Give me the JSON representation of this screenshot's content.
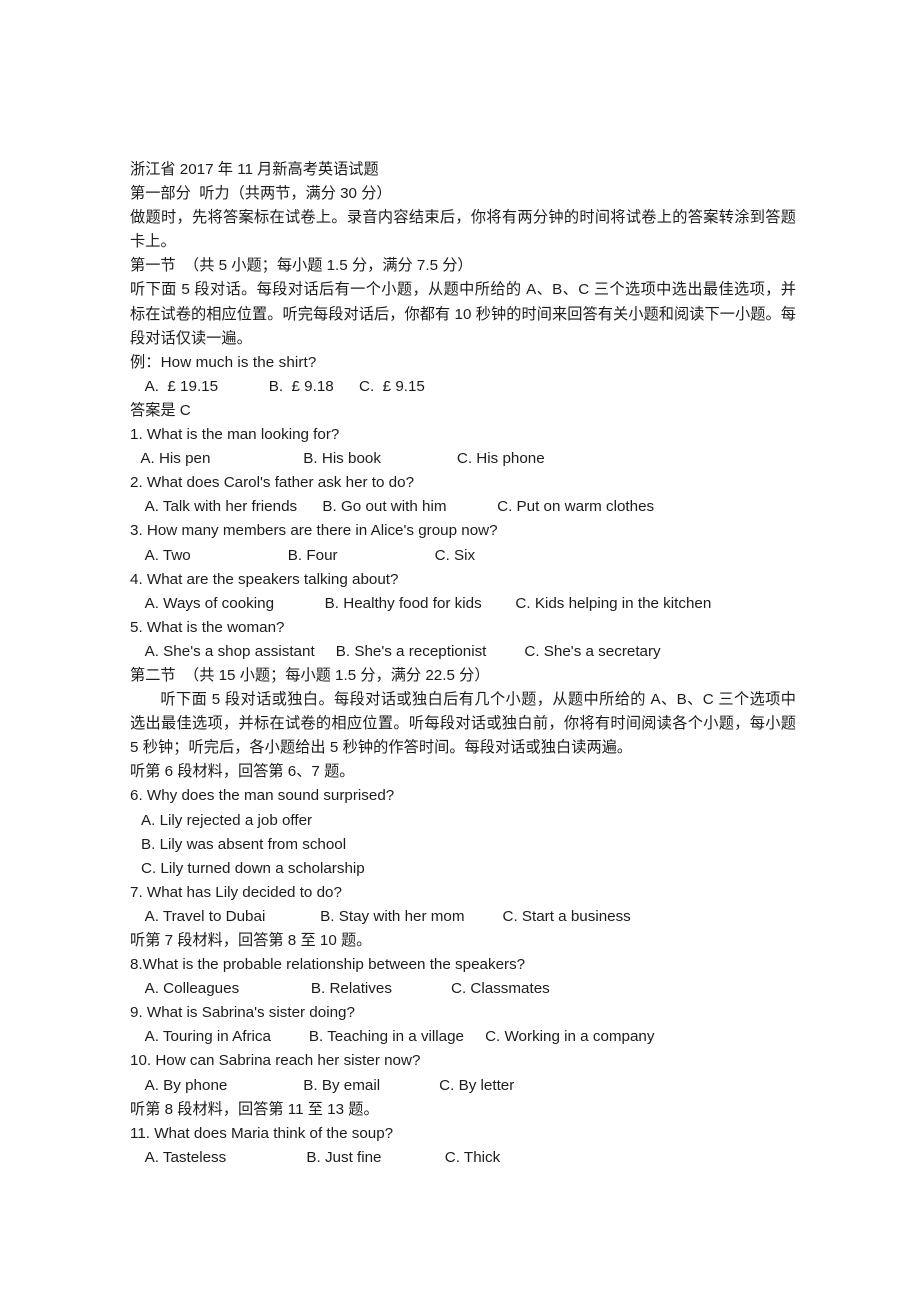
{
  "document": {
    "title": "浙江省 2017 年 11 月新高考英语试题",
    "part_one_heading": "第一部分  听力（共两节，满分 30 分）",
    "part_one_instruction": "做题时，先将答案标在试卷上。录音内容结束后，你将有两分钟的时间将试卷上的答案转涂到答题卡上。",
    "section_one": {
      "heading": "第一节  （共 5 小题；每小题 1.5 分，满分 7.5 分）",
      "instruction": "听下面 5 段对话。每段对话后有一个小题，从题中所给的 A、B、C 三个选项中选出最佳选项，并标在试卷的相应位置。听完每段对话后，你都有 10 秒钟的时间来回答有关小题和阅读下一小题。每段对话仅读一遍。",
      "example_label": "例：How much is the shirt?",
      "example_options": "  A.  £ 19.15            B.  £ 9.18      C.  £ 9.15",
      "example_answer": "答案是 C",
      "questions": [
        {
          "stem": "1. What is the man looking for?",
          "options_line": " A. His pen                      B. His book                  C. His phone"
        },
        {
          "stem": "2. What does Carol's father ask her to do?",
          "options_line": "  A. Talk with her friends      B. Go out with him            C. Put on warm clothes"
        },
        {
          "stem": "3. How many members are there in Alice's group now?",
          "options_line": "  A. Two                       B. Four                       C. Six"
        },
        {
          "stem": "4. What are the speakers talking about?",
          "options_line": "  A. Ways of cooking            B. Healthy food for kids        C. Kids helping in the kitchen"
        },
        {
          "stem": "5. What is the woman?",
          "options_line": "  A. She's a shop assistant     B. She's a receptionist         C. She's a secretary"
        }
      ]
    },
    "section_two": {
      "heading": "第二节  （共 15 小题；每小题 1.5 分，满分 22.5 分）",
      "instruction": "听下面 5 段对话或独白。每段对话或独白后有几个小题，从题中所给的 A、B、C 三个选项中选出最佳选项，并标在试卷的相应位置。听每段对话或独白前，你将有时间阅读各个小题，每小题 5 秒钟；听完后，各小题给出 5 秒钟的作答时间。每段对话或独白读两遍。",
      "material_6": "听第 6 段材料，回答第 6、7 题。",
      "q6_stem": "6. Why does the man sound surprised?",
      "q6_options": [
        "A. Lily rejected a job offer",
        "B. Lily was absent from school",
        "C. Lily turned down a scholarship"
      ],
      "q7_stem": "7. What has Lily decided to do?",
      "q7_options_line": "  A. Travel to Dubai             B. Stay with her mom         C. Start a business",
      "material_7": "听第 7 段材料，回答第 8 至 10 题。",
      "q8_stem": "8.What is the probable relationship between the speakers?",
      "q8_options_line": "  A. Colleagues                 B. Relatives              C. Classmates",
      "q9_stem": "9. What is Sabrina's sister doing?",
      "q9_options_line": "  A. Touring in Africa         B. Teaching in a village     C. Working in a company",
      "q10_stem": "10. How can Sabrina reach her sister now?",
      "q10_options_line": "  A. By phone                  B. By email              C. By letter",
      "material_8": "听第 8 段材料，回答第 11 至 13 题。",
      "q11_stem": "11. What does Maria think of the soup?",
      "q11_options_line": "  A. Tasteless                   B. Just fine               C. Thick"
    }
  }
}
